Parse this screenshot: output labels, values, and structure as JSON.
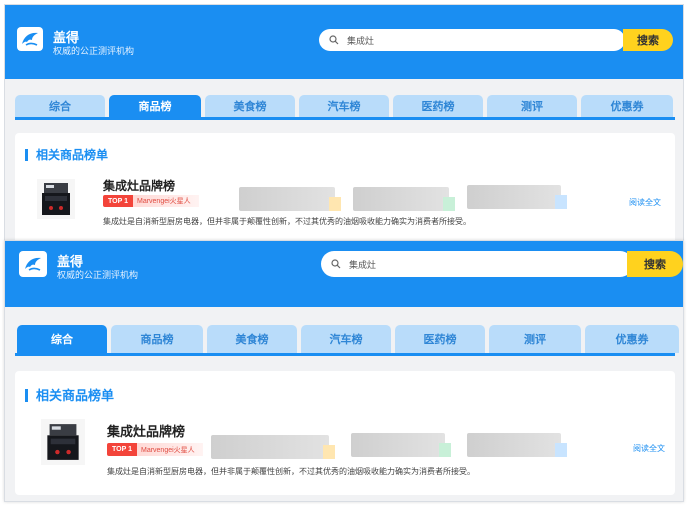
{
  "brand": {
    "name": "盖得",
    "tagline": "权威的公正测评机构"
  },
  "search": {
    "value": "集成灶",
    "button_label": "搜索"
  },
  "tabs": [
    {
      "label": "综合"
    },
    {
      "label": "商品榜"
    },
    {
      "label": "美食榜"
    },
    {
      "label": "汽车榜"
    },
    {
      "label": "医药榜"
    },
    {
      "label": "测评"
    },
    {
      "label": "优惠券"
    }
  ],
  "section": {
    "title": "相关商品榜单"
  },
  "product": {
    "name": "集成灶品牌榜",
    "rank_badge": "TOP 1",
    "rank_label": "Marvengei火星人",
    "description": "集成灶是自消新型厨房电器，但并非属于颠覆性创新，不过其优秀的油烟吸收能力确实为消费者所接受。",
    "read_more": "阅读全文"
  },
  "views": [
    {
      "active_tab": "商品榜"
    },
    {
      "active_tab": "综合"
    }
  ],
  "colors": {
    "primary": "#1a8ef2",
    "tab_inactive_bg": "#b9dcfa",
    "search_button": "#ffd21e",
    "badge_red": "#f3443a"
  }
}
